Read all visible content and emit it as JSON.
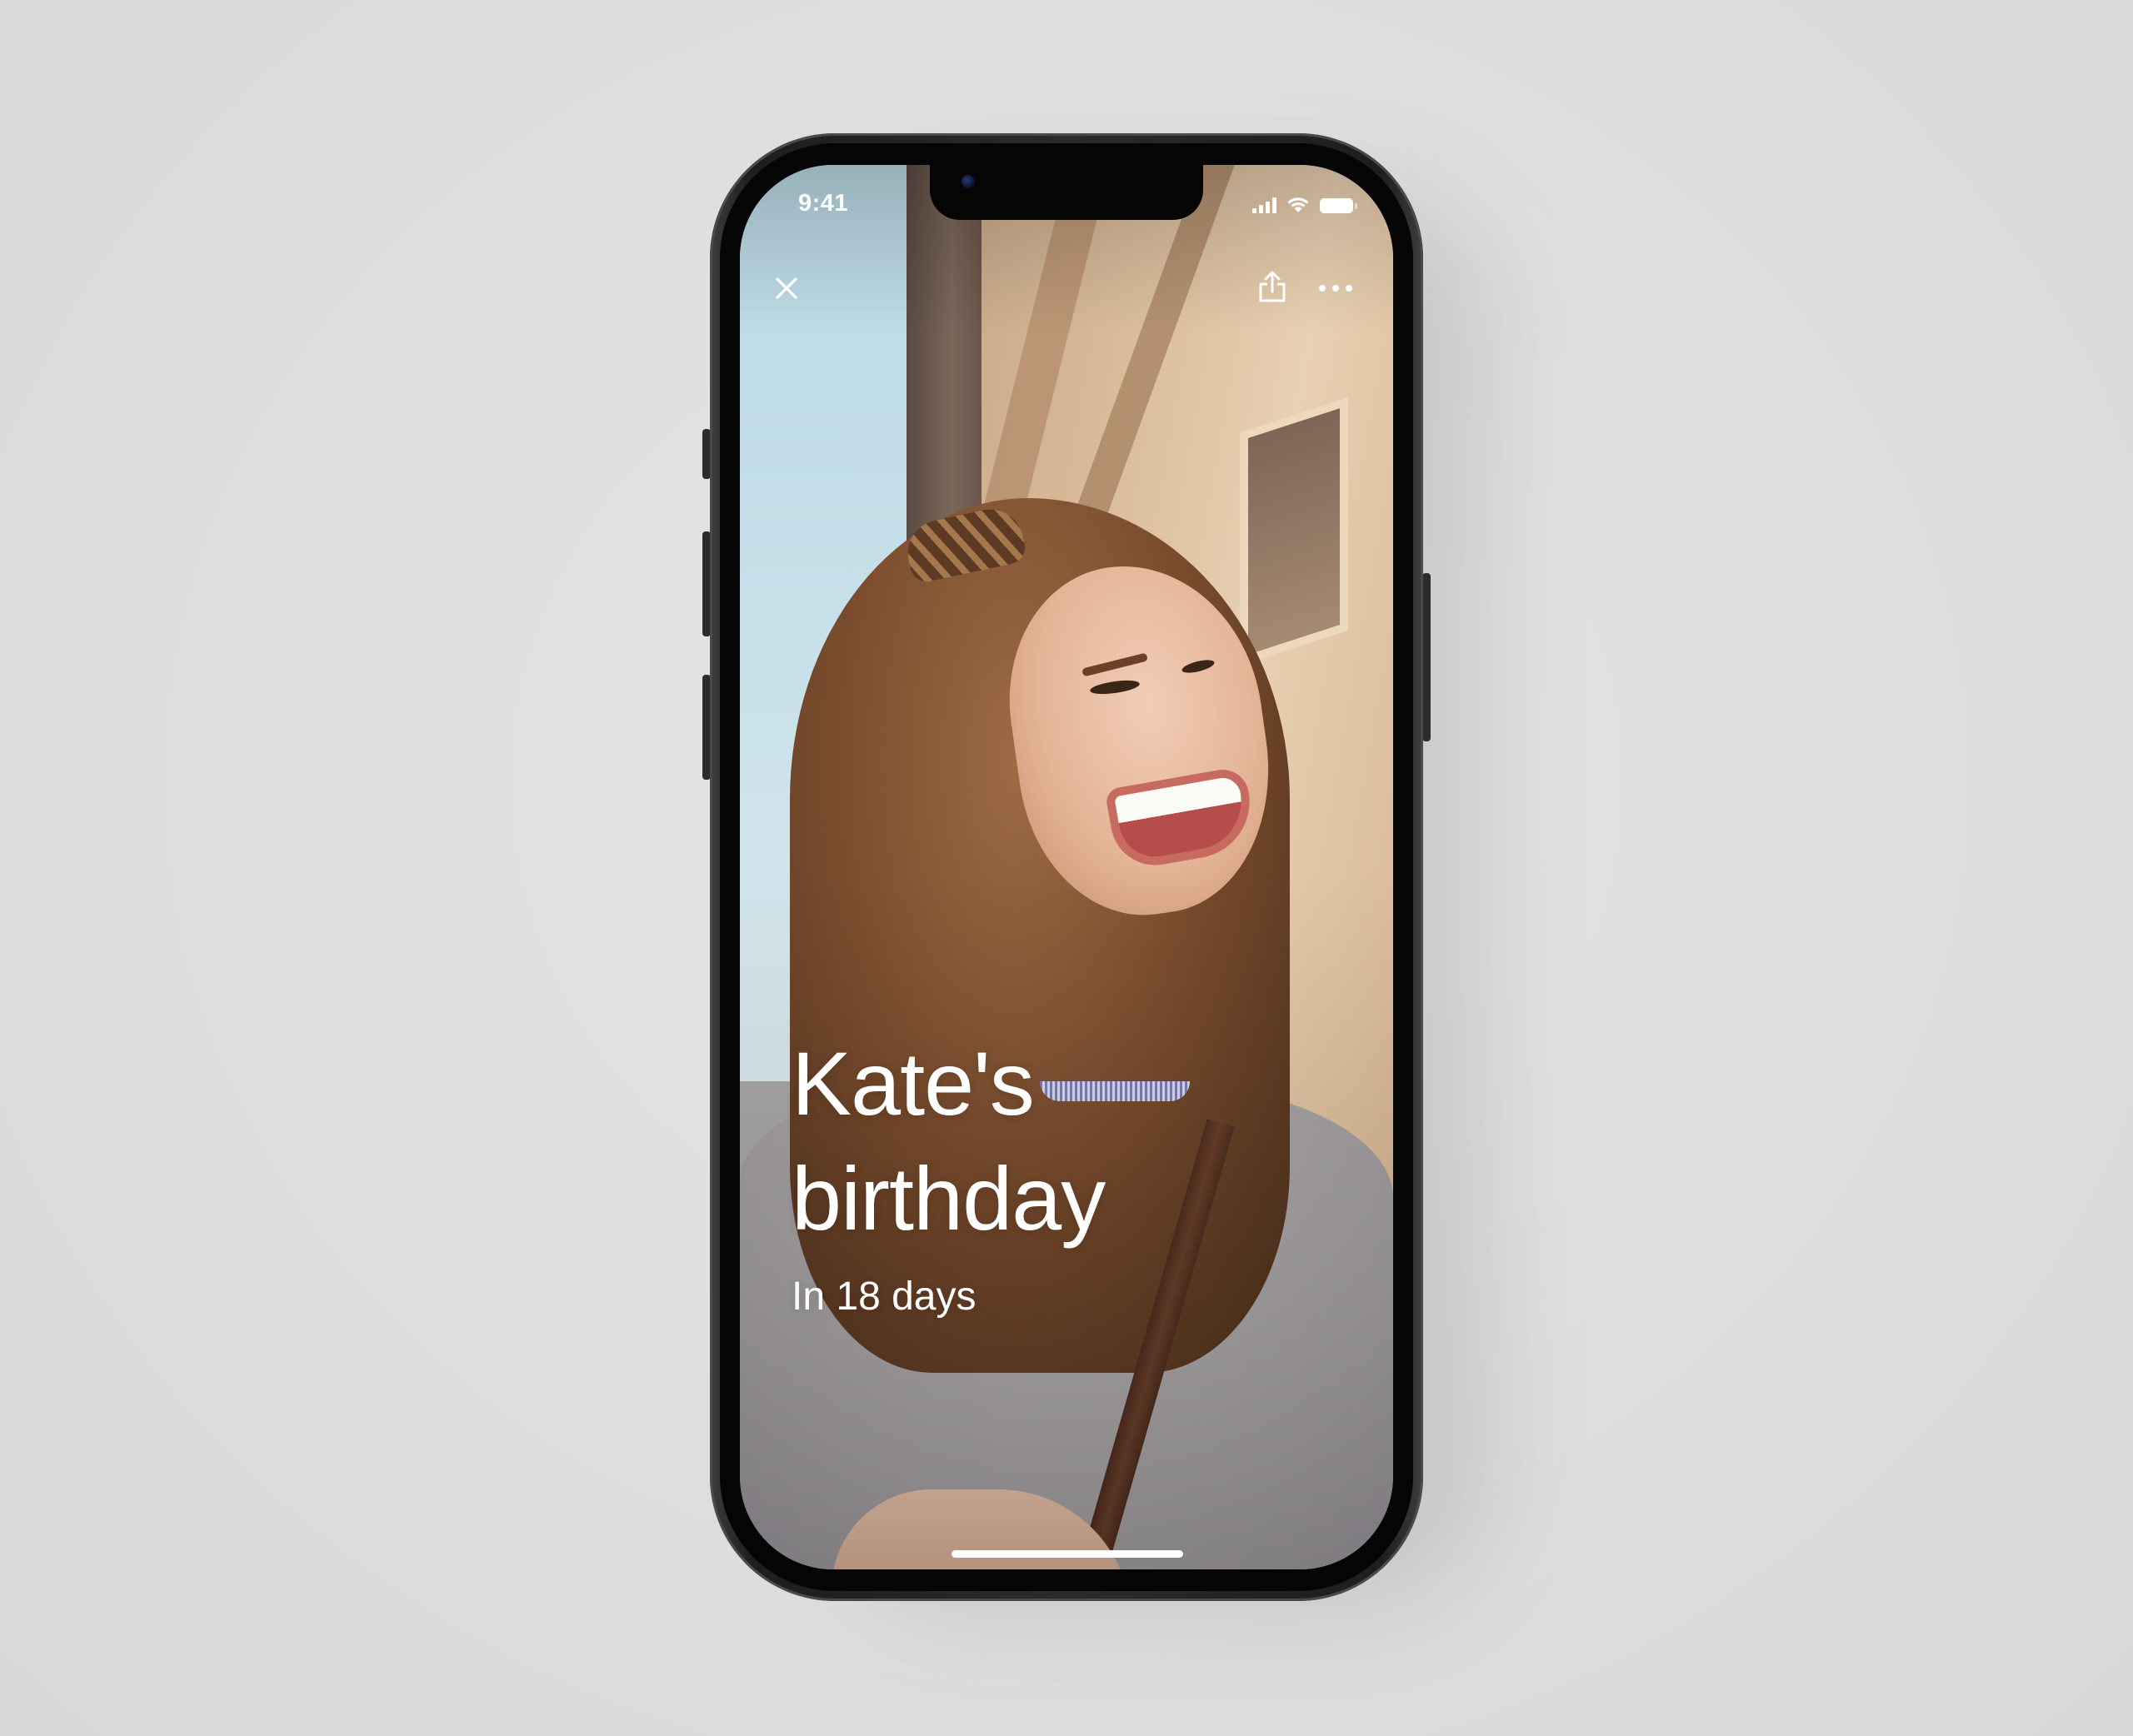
{
  "status_bar": {
    "time": "9:41"
  },
  "top_bar": {
    "close_icon": "close-icon",
    "share_icon": "share-icon",
    "more_icon": "more-icon"
  },
  "card": {
    "title_line1": "Kate's",
    "title_line2": "birthday",
    "subtitle": "In 18 days"
  },
  "colors": {
    "text": "#ffffff",
    "background": "#dedede",
    "frame": "#2a2a2c"
  }
}
